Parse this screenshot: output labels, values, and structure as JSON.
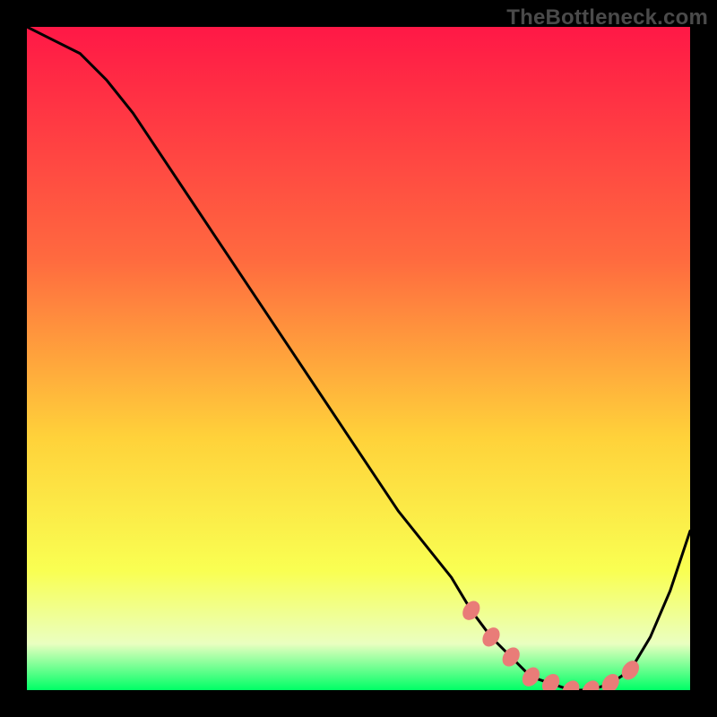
{
  "watermark": "TheBottleneck.com",
  "colors": {
    "bg": "#000000",
    "curve": "#000000",
    "marker_fill": "#e97c78",
    "marker_stroke": "#e97c78",
    "grad_top": "#ff1846",
    "grad_upper_mid": "#ff6a3f",
    "grad_mid": "#ffd23a",
    "grad_lower_mid": "#f9ff52",
    "grad_pale": "#eaffc0",
    "grad_bottom": "#00ff66"
  },
  "chart_data": {
    "type": "line",
    "title": "",
    "xlabel": "",
    "ylabel": "",
    "xlim": [
      0,
      100
    ],
    "ylim": [
      0,
      100
    ],
    "grid": false,
    "legend": false,
    "series": [
      {
        "name": "bottleneck-curve",
        "x": [
          0,
          4,
          8,
          12,
          16,
          20,
          24,
          28,
          32,
          36,
          40,
          44,
          48,
          52,
          56,
          60,
          64,
          67,
          70,
          73,
          76,
          79,
          82,
          85,
          88,
          91,
          94,
          97,
          100
        ],
        "values": [
          100,
          98,
          96,
          92,
          87,
          81,
          75,
          69,
          63,
          57,
          51,
          45,
          39,
          33,
          27,
          22,
          17,
          12,
          8,
          5,
          2,
          1,
          0,
          0,
          1,
          3,
          8,
          15,
          24
        ]
      }
    ],
    "markers": {
      "name": "bottleneck-markers",
      "points": [
        {
          "x": 67,
          "y": 12
        },
        {
          "x": 70,
          "y": 8
        },
        {
          "x": 73,
          "y": 5
        },
        {
          "x": 76,
          "y": 2
        },
        {
          "x": 79,
          "y": 1
        },
        {
          "x": 82,
          "y": 0
        },
        {
          "x": 85,
          "y": 0
        },
        {
          "x": 88,
          "y": 1
        },
        {
          "x": 91,
          "y": 3
        }
      ]
    }
  }
}
